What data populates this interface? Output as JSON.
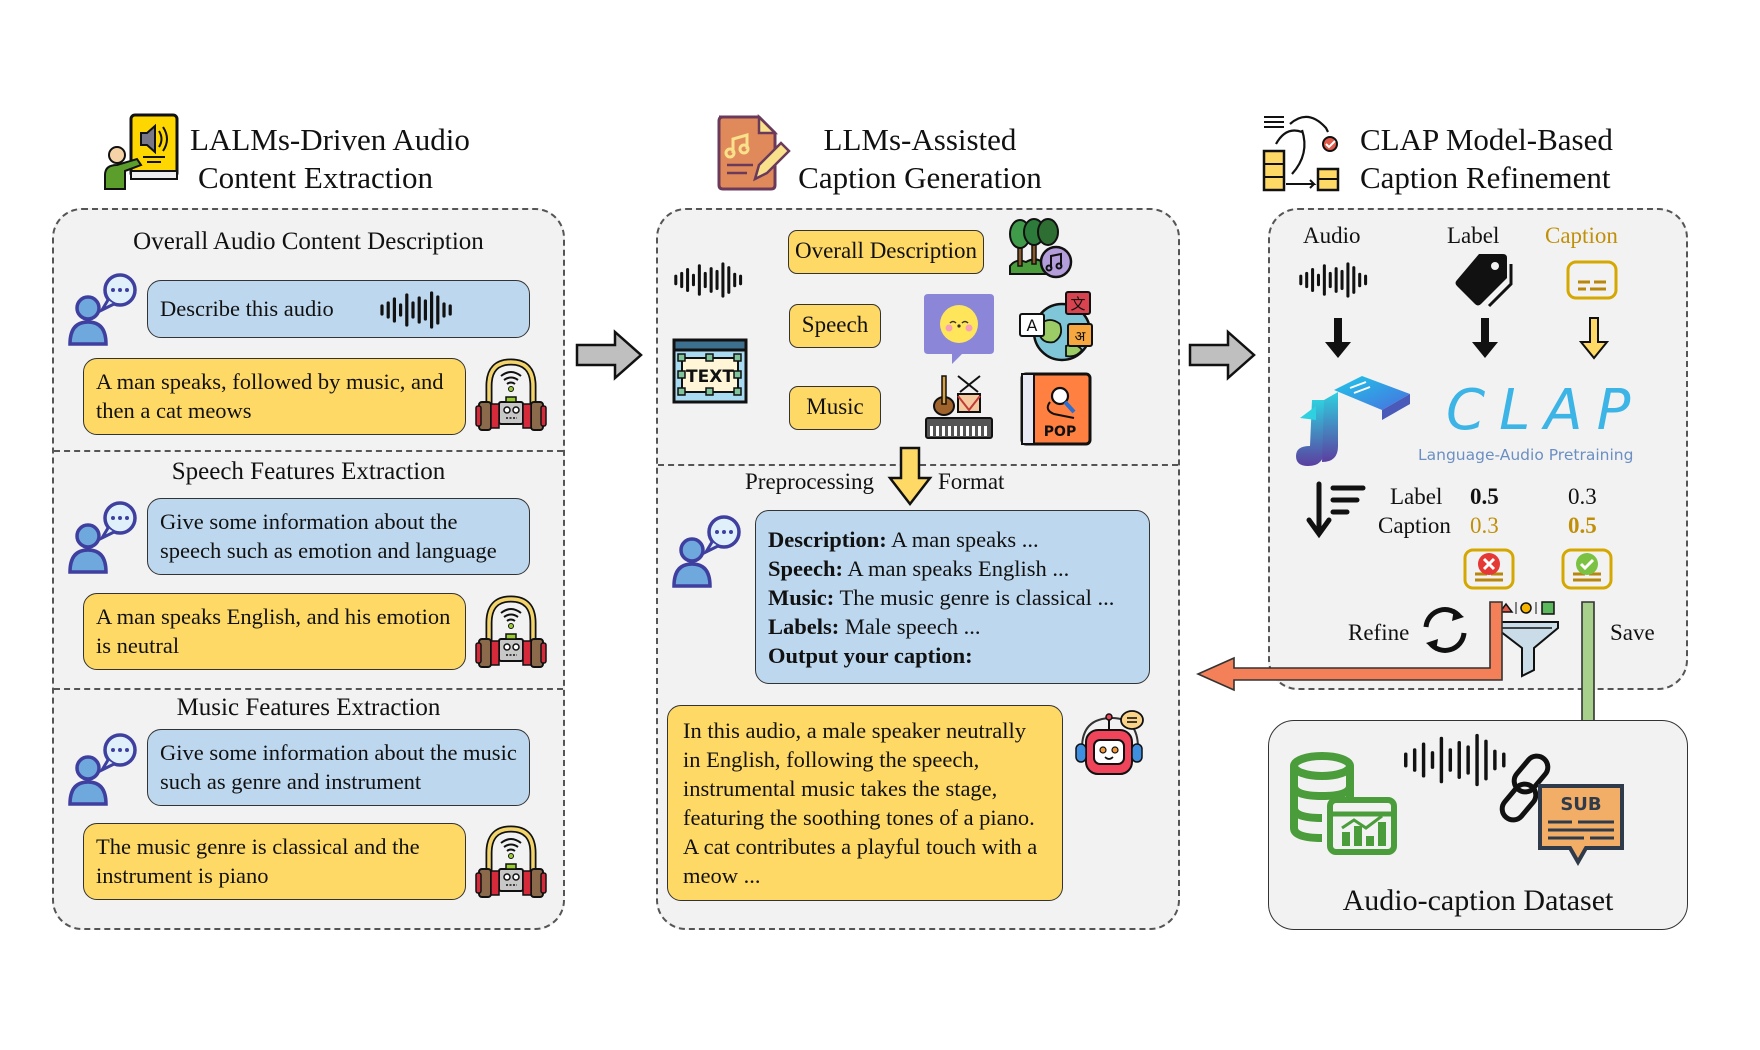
{
  "stages": {
    "extraction": {
      "title_line1": "LALMs-Driven Audio",
      "title_line2": "Content Extraction",
      "sections": [
        {
          "title": "Overall Audio Content Description",
          "prompt": "Describe this audio",
          "response": "A man speaks, followed by music, and then a cat meows"
        },
        {
          "title": "Speech Features Extraction",
          "prompt": "Give some information about the speech such as emotion and language",
          "response": "A man speaks English, and his emotion is neutral"
        },
        {
          "title": "Music Features Extraction",
          "prompt": "Give some information about the music such as genre and instrument",
          "response": "The music genre is classical and the instrument is piano"
        }
      ]
    },
    "generation": {
      "title_line1": "LLMs-Assisted",
      "title_line2": "Caption Generation",
      "tags": [
        "Overall Description",
        "Speech",
        "Music"
      ],
      "text_icon_label": "TEXT",
      "pop_label": "POP",
      "preprocessing_label": "Preprocessing",
      "format_label": "Format",
      "prompt_lines": [
        {
          "key": "Description:",
          "value": " A man speaks ..."
        },
        {
          "key": "Speech:",
          "value": " A man speaks English ..."
        },
        {
          "key": "Music:",
          "value": " The music genre is classical ..."
        },
        {
          "key": "Labels:",
          "value": " Male speech ..."
        },
        {
          "key": "Output your caption:",
          "value": ""
        }
      ],
      "caption": "In this audio, a male speaker neutrally in English, following the speech, instrumental music takes the stage, featuring the soothing tones of a piano. A cat contributes a playful touch with a meow ..."
    },
    "refinement": {
      "title_line1": "CLAP Model-Based",
      "title_line2": "Caption Refinement",
      "inputs": [
        "Audio",
        "Label",
        "Caption"
      ],
      "clap_logo": "CLAP",
      "clap_subtitle": "Language-Audio Pretraining",
      "score_rows": [
        {
          "name": "Label",
          "left": "0.5",
          "right": "0.3"
        },
        {
          "name": "Caption",
          "left": "0.3",
          "right": "0.5"
        }
      ],
      "refine_label": "Refine",
      "save_label": "Save"
    },
    "dataset": {
      "title": "Audio-caption Dataset",
      "sub_label": "SUB"
    }
  },
  "colors": {
    "panel_bg": "#f2f2f2",
    "prompt_blue": "#bdd7ee",
    "response_yellow": "#ffd966",
    "caption_gold": "#c0900a",
    "refine_orange": "#f4805a",
    "save_green": "#a8d08d",
    "arrow_gray": "#bfbfbf"
  }
}
